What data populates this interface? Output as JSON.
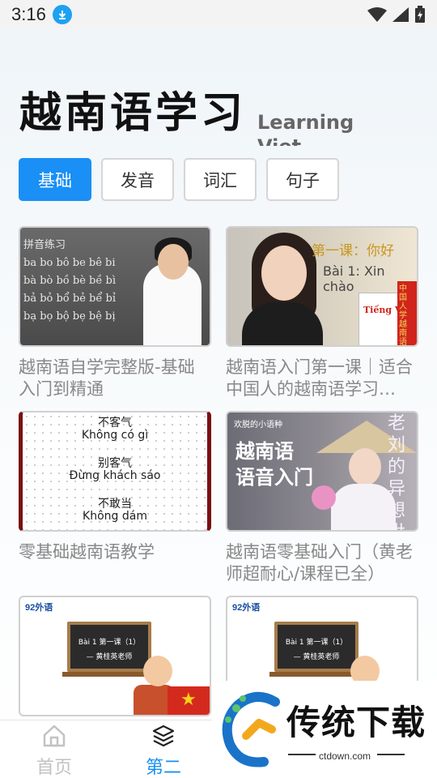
{
  "status_bar": {
    "time": "3:16",
    "icons": [
      "download-icon",
      "wifi-icon",
      "signal-icon",
      "battery-charging-icon"
    ]
  },
  "header": {
    "title": "越南语学习",
    "subtitle": "Learning Viet"
  },
  "tabs": [
    {
      "label": "基础",
      "active": true
    },
    {
      "label": "发音",
      "active": false
    },
    {
      "label": "词汇",
      "active": false
    },
    {
      "label": "句子",
      "active": false
    }
  ],
  "courses": [
    {
      "title": "越南语自学完整版-基础入门到精通",
      "thumb_text": {
        "heading": "拼音练习",
        "rows": [
          "ba  bo  bô  be  bê  bi",
          "bà  bò  bồ  bè  bề  bì",
          "bả  bỏ  bổ  bẻ  bể  bỉ",
          "bạ  bọ  bộ  bẹ  bệ  bị"
        ]
      }
    },
    {
      "title": "越南语入门第一课｜适合中国人的越南语学习…",
      "thumb_text": {
        "lesson_cn": "第一课：你好",
        "lesson_vn": "Bài 1: Xin chào",
        "book": "Tiếng Việt",
        "book_side": "中国人学越南语"
      }
    },
    {
      "title": "零基础越南语教学",
      "thumb_text": {
        "lines": [
          "不客气",
          "Không có gì",
          "别客气",
          "Đừng khách sáo",
          "不敢当",
          "Không dám"
        ]
      }
    },
    {
      "title": "越南语零基础入门（黄老师超耐心/课程已全）",
      "thumb_text": {
        "small": "欢脱的小语种",
        "big1": "越南语",
        "big2": "语音入门",
        "vertical": "老刘的异想世界"
      }
    },
    {
      "title": "",
      "thumb_text": {
        "logo": "92外语",
        "board1": "Bài 1   第一课（1）",
        "board2": "— 黄桂英老师"
      }
    },
    {
      "title": "",
      "thumb_text": {
        "logo": "92外语",
        "board1": "Bài 1   第一课（1）",
        "board2": "— 黄桂英老师"
      }
    }
  ],
  "bottom_nav": [
    {
      "label": "首页",
      "icon": "home-icon",
      "active": false
    },
    {
      "label": "第二",
      "icon": "layers-icon",
      "active": true
    }
  ],
  "watermark": {
    "brand": "传统下载",
    "url": "ctdown.com"
  },
  "colors": {
    "accent": "#1a8ff5",
    "inactive": "#c2c2c2",
    "caption": "#888888"
  }
}
